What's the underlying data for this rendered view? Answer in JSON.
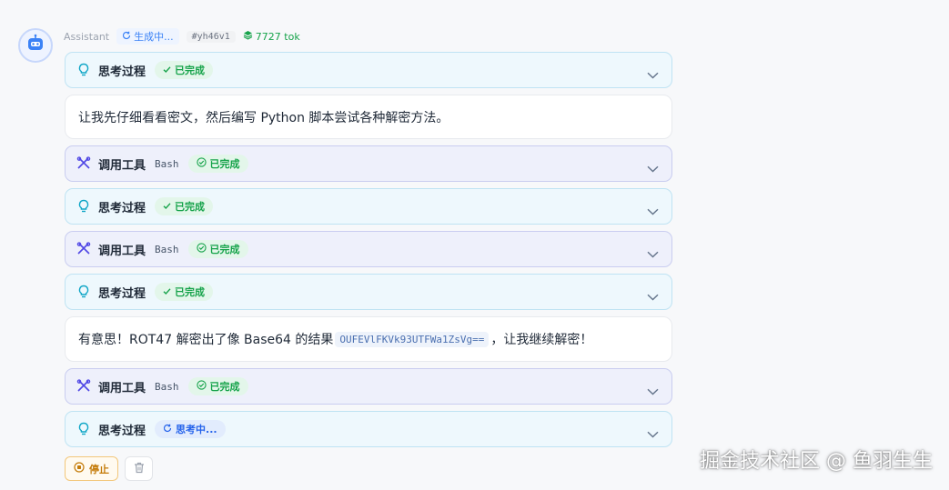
{
  "header": {
    "role": "Assistant",
    "status": "生成中...",
    "message_id": "#yh46v1",
    "tokens": "7727 tok"
  },
  "blocks": {
    "b1": {
      "title": "思考过程",
      "status": "已完成"
    },
    "b2": {
      "text": "让我先仔细看看密文，然后编写 Python 脚本尝试各种解密方法。"
    },
    "b3": {
      "title": "调用工具",
      "tool": "Bash",
      "status": "已完成"
    },
    "b4": {
      "title": "思考过程",
      "status": "已完成"
    },
    "b5": {
      "title": "调用工具",
      "tool": "Bash",
      "status": "已完成"
    },
    "b6": {
      "title": "思考过程",
      "status": "已完成"
    },
    "b7": {
      "text_before": "有意思！ROT47 解密出了像 Base64 的结果",
      "code": "OUFEVlFKVk93UTFWa1ZsVg==",
      "text_after": "，让我继续解密！"
    },
    "b8": {
      "title": "调用工具",
      "tool": "Bash",
      "status": "已完成"
    },
    "b9": {
      "title": "思考过程",
      "status": "思考中..."
    }
  },
  "actions": {
    "stop_label": "停止"
  },
  "watermark": "掘金技术社区 @ 鱼羽生生",
  "colors": {
    "think_bg": "#eef8fd",
    "tool_bg": "#eef0fb",
    "done_green": "#16a34a",
    "progress_blue": "#2563eb",
    "stop_orange": "#c47a07"
  }
}
